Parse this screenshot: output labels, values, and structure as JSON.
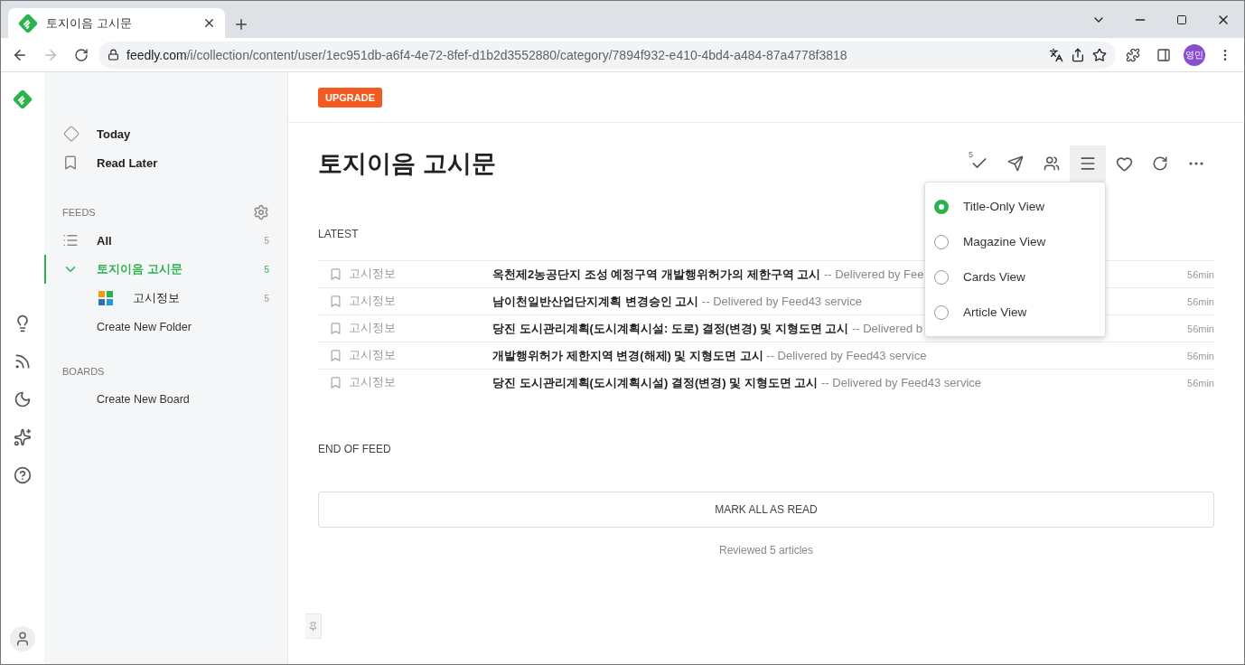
{
  "browser": {
    "tab_title": "토지이음 고시문",
    "url_host": "feedly.com",
    "url_path": "/i/collection/content/user/1ec951db-a6f4-4e72-8fef-d1b2d3552880/category/7894f932-e410-4bd4-a484-87a4778f3818",
    "avatar": "영민"
  },
  "sidebar": {
    "nav": [
      {
        "kind": "today",
        "label": "Today"
      },
      {
        "kind": "read_later",
        "label": "Read Later"
      }
    ],
    "feeds_heading": "FEEDS",
    "feeds": [
      {
        "kind": "all",
        "label": "All",
        "count": "5",
        "selected": false
      },
      {
        "kind": "folder",
        "label": "토지이음 고시문",
        "count": "5",
        "selected": true,
        "expanded": true,
        "children": [
          {
            "label": "고시정보",
            "count": "5"
          }
        ]
      }
    ],
    "create_folder": "Create New Folder",
    "boards_heading": "BOARDS",
    "create_board": "Create New Board"
  },
  "main": {
    "upgrade": "UPGRADE",
    "title": "토지이음 고시문",
    "unread_count": "5",
    "view_menu_open": true,
    "view_options": [
      {
        "label": "Title-Only View",
        "selected": true
      },
      {
        "label": "Magazine View",
        "selected": false
      },
      {
        "label": "Cards View",
        "selected": false
      },
      {
        "label": "Article View",
        "selected": false
      }
    ],
    "section": "LATEST",
    "articles": [
      {
        "source": "고시정보",
        "title": "옥천제2농공단지 조성 예정구역 개발행위허가의 제한구역 고시",
        "summary": "-- Delivered by Fee",
        "time": "56min"
      },
      {
        "source": "고시정보",
        "title": "남이천일반산업단지계획 변경승인 고시",
        "summary": "-- Delivered by Feed43 service",
        "time": "56min"
      },
      {
        "source": "고시정보",
        "title": "당진 도시관리계획(도시계획시설: 도로) 결정(변경) 및 지형도면 고시",
        "summary": "-- Delivered b",
        "time": "56min"
      },
      {
        "source": "고시정보",
        "title": "개발행위허가 제한지역 변경(해제) 및 지형도면 고시",
        "summary": "-- Delivered by Feed43 service",
        "time": "56min"
      },
      {
        "source": "고시정보",
        "title": "당진 도시관리계획(도시계획시설) 결정(변경) 및 지형도면 고시",
        "summary": "-- Delivered by Feed43 service",
        "time": "56min"
      }
    ],
    "end_label": "END OF FEED",
    "mark_all": "MARK ALL AS READ",
    "reviewed": "Reviewed 5 articles"
  }
}
